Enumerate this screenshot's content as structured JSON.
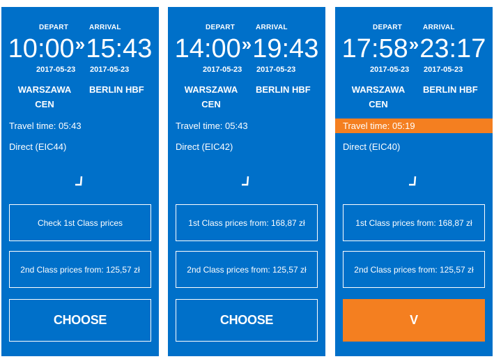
{
  "labels": {
    "depart": "DEPART",
    "arrival": "ARRIVAL"
  },
  "colors": {
    "card": "#0070c9",
    "accent": "#f47f20",
    "text": "#ffffff"
  },
  "icons": {
    "separator": "double-chevron-right-icon",
    "status": "corner-check-icon"
  },
  "cards": [
    {
      "depart_time": "10:00",
      "arrive_time": "15:43",
      "separator": "»",
      "depart_date": "2017-05-23",
      "arrive_date": "2017-05-23",
      "depart_station": "WARSZAWA CEN",
      "arrive_station": "BERLIN HBF",
      "travel_time": "Travel time: 05:43",
      "travel_highlight": false,
      "connection": "Direct (EIC44)",
      "first_class": "Check 1st Class prices",
      "second_class": "2nd Class prices from: 125,57 zł",
      "choose": "CHOOSE",
      "selected": false
    },
    {
      "depart_time": "14:00",
      "arrive_time": "19:43",
      "separator": "»",
      "depart_date": "2017-05-23",
      "arrive_date": "2017-05-23",
      "depart_station": "WARSZAWA CEN",
      "arrive_station": "BERLIN HBF",
      "travel_time": "Travel time: 05:43",
      "travel_highlight": false,
      "connection": "Direct (EIC42)",
      "first_class": "1st Class prices from: 168,87 zł",
      "second_class": "2nd Class prices from: 125,57 zł",
      "choose": "CHOOSE",
      "selected": false
    },
    {
      "depart_time": "17:58",
      "arrive_time": "23:17",
      "separator": "»",
      "depart_date": "2017-05-23",
      "arrive_date": "2017-05-23",
      "depart_station": "WARSZAWA CEN",
      "arrive_station": "BERLIN HBF",
      "travel_time": "Travel time: 05:19",
      "travel_highlight": true,
      "connection": "Direct (EIC40)",
      "first_class": "1st Class prices from: 168,87 zł",
      "second_class": "2nd Class prices from: 125,57 zł",
      "choose": "V",
      "selected": true
    }
  ]
}
